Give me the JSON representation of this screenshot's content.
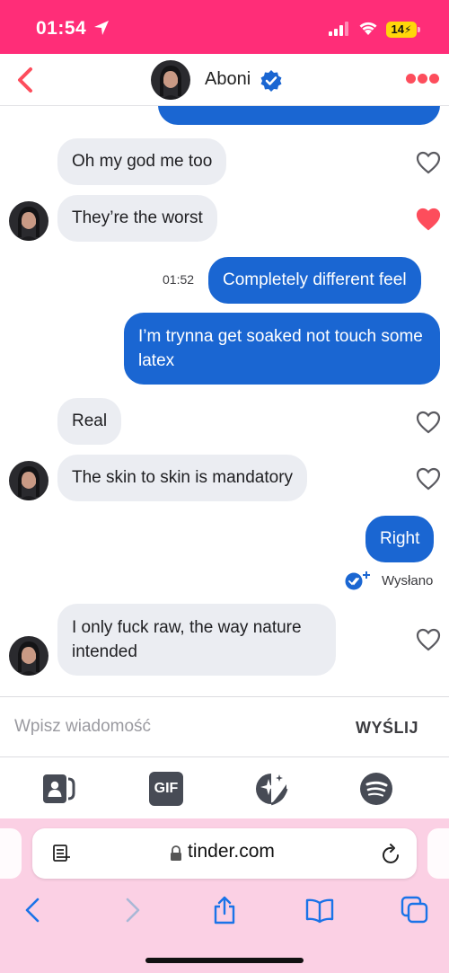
{
  "status_bar": {
    "time": "01:54",
    "battery": "14",
    "location-icon": "location-arrow-icon",
    "signal-icon": "cellular-signal-icon",
    "wifi-icon": "wifi-icon"
  },
  "header": {
    "name": "Aboni",
    "back_icon": "chevron-left-icon",
    "verified_icon": "verified-badge-icon",
    "more_icon": "more-dots-icon",
    "accent": "#fd4d5c"
  },
  "messages": {
    "m1": {
      "text": "Oh my god me too",
      "liked": false
    },
    "m2": {
      "text": "They’re the worst",
      "liked": true
    },
    "m3": {
      "text": "Completely different feel",
      "time": "01:52"
    },
    "m4": {
      "text": "I’m trynna get soaked not touch some latex"
    },
    "m5": {
      "text": "Real",
      "liked": false
    },
    "m6": {
      "text": "The skin to skin is mandatory",
      "liked": false
    },
    "m7": {
      "text": "Right",
      "status": "Wysłano"
    },
    "m8": {
      "text": "I only fuck raw, the way nature intended",
      "liked": false
    }
  },
  "colors": {
    "outgoing_bubble": "#1a66d2",
    "incoming_bubble": "#ebedf2",
    "heart_liked": "#fd4d5c",
    "status_bar": "#ff2d78",
    "browser_bar": "#fbd0e4"
  },
  "composer": {
    "placeholder": "Wpisz wiadomość",
    "send_label": "WYŚLIJ"
  },
  "attachments": [
    "contact-card-icon",
    "gif-icon",
    "sparkle-sticker-icon",
    "spotify-icon"
  ],
  "attachments_gif_label": "GIF",
  "browser": {
    "url": "tinder.com",
    "icons": [
      "reader-icon",
      "lock-icon",
      "reload-icon",
      "back-icon",
      "forward-icon",
      "share-icon",
      "bookmarks-icon",
      "tabs-icon"
    ]
  }
}
